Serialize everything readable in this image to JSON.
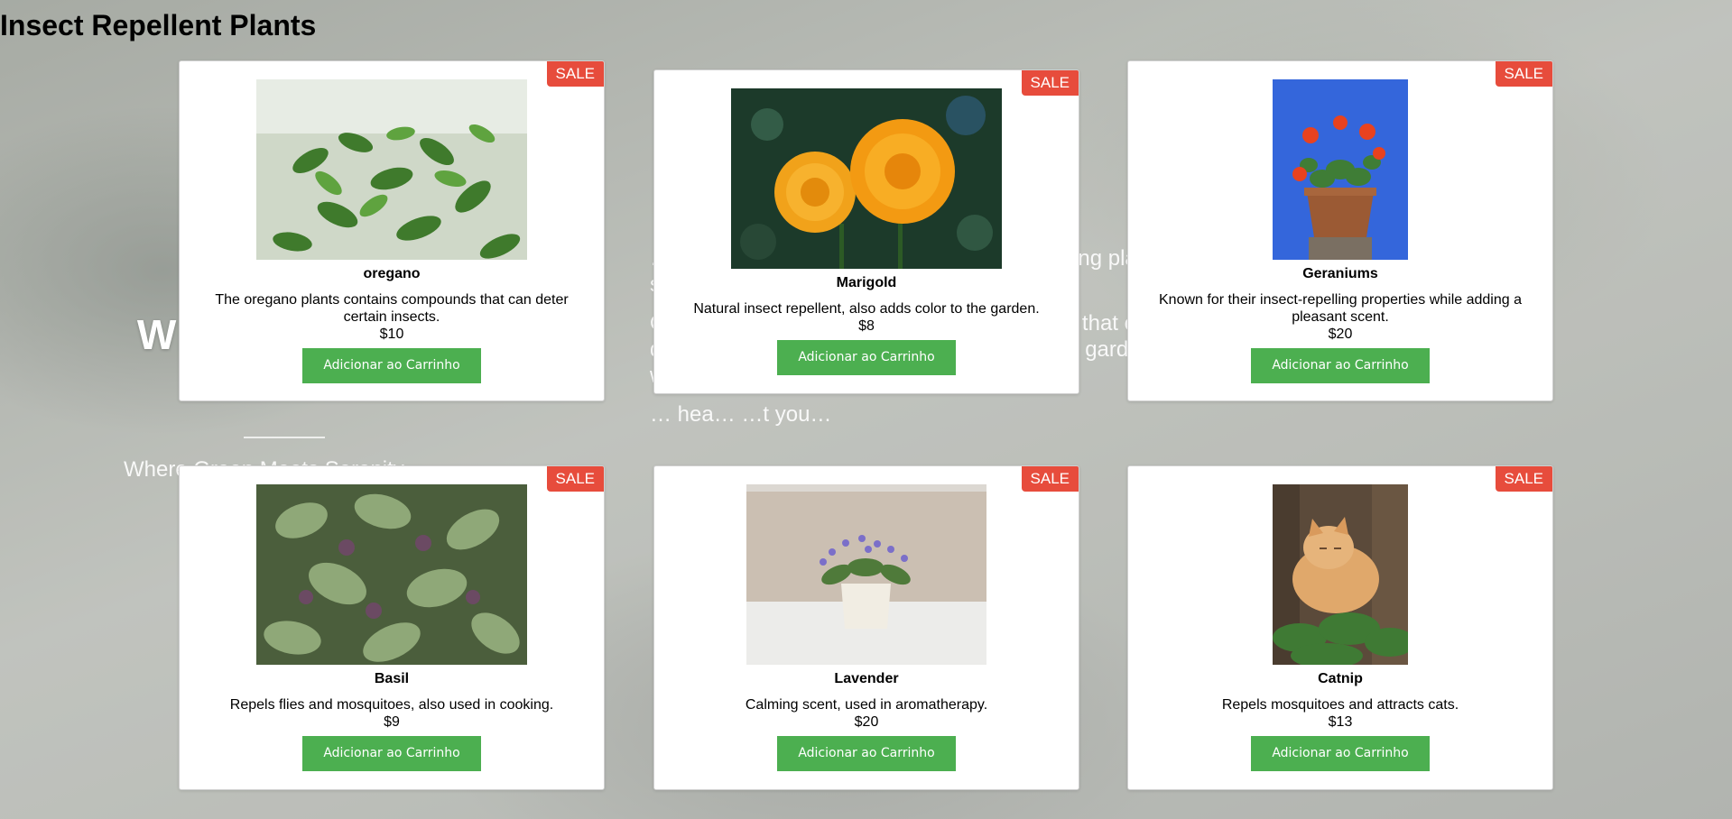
{
  "page": {
    "title": "Insect Repellent Plants"
  },
  "hero": {
    "title_partial": "W… Para… y",
    "tagline_partial": "Where Green Meets Serenity",
    "paragraphs": [
      "…ery, w… …bout … plants … thier … purifying plants to aromatic fragrant ones, we have something",
      "Our team of experts is dedicated to ensuring that each plant meets our strict standards of quality and care. Whether you're a seasoned gardener or just starting your green journey, … we … …ect pl…",
      "… hea… …t you…"
    ]
  },
  "sale_badge": "SALE",
  "add_to_cart_label": "Adicionar ao Carrinho",
  "products": [
    {
      "name": "oregano",
      "description": "The oregano plants contains compounds that can deter certain insects.",
      "price": "$10",
      "image": "oregano-photo"
    },
    {
      "name": "Marigold",
      "description": "Natural insect repellent, also adds color to the garden.",
      "price": "$8",
      "image": "marigold-photo"
    },
    {
      "name": "Geraniums",
      "description": "Known for their insect-repelling properties while adding a pleasant scent.",
      "price": "$20",
      "image": "geranium-photo"
    },
    {
      "name": "Basil",
      "description": "Repels flies and mosquitoes, also used in cooking.",
      "price": "$9",
      "image": "basil-photo"
    },
    {
      "name": "Lavender",
      "description": "Calming scent, used in aromatherapy.",
      "price": "$20",
      "image": "lavender-photo"
    },
    {
      "name": "Catnip",
      "description": "Repels mosquitoes and attracts cats.",
      "price": "$13",
      "image": "catnip-photo"
    }
  ],
  "colors": {
    "sale": "#e74c3c",
    "button": "#4caf50",
    "card_border": "#cfcfcf"
  }
}
